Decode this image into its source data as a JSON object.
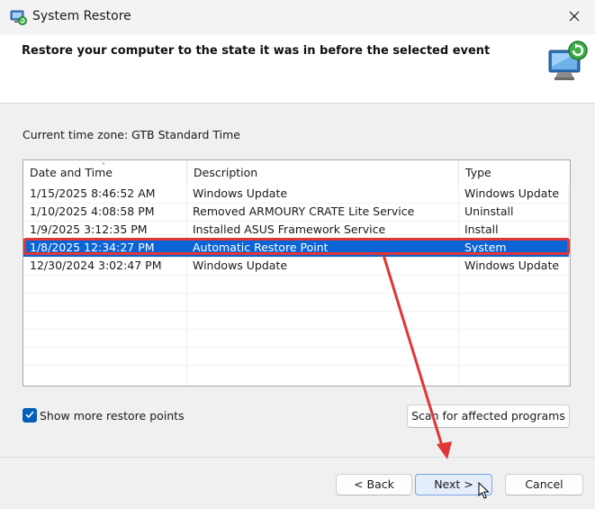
{
  "window": {
    "title": "System Restore",
    "close_icon": "close-icon",
    "app_icon": "system-restore-icon"
  },
  "header": {
    "title": "Restore your computer to the state it was in before the selected event",
    "icon": "system-restore-computer-icon"
  },
  "timezone_label": "Current time zone: GTB Standard Time",
  "list": {
    "columns": [
      "Date and Time",
      "Description",
      "Type"
    ],
    "sort_indicator": "˅",
    "rows": [
      {
        "date": "1/15/2025 8:46:52 AM",
        "description": "Windows Update",
        "type": "Windows Update"
      },
      {
        "date": "1/10/2025 4:08:58 PM",
        "description": "Removed ARMOURY CRATE Lite Service",
        "type": "Uninstall"
      },
      {
        "date": "1/9/2025 3:12:35 PM",
        "description": "Installed ASUS Framework Service",
        "type": "Install"
      },
      {
        "date": "1/8/2025 12:34:27 PM",
        "description": "Automatic Restore Point",
        "type": "System"
      },
      {
        "date": "12/30/2024 3:02:47 PM",
        "description": "Windows Update",
        "type": "Windows Update"
      }
    ],
    "selected_index": 3
  },
  "show_more": {
    "label": "Show more restore points",
    "checked": true
  },
  "buttons": {
    "scan": "Scan for affected programs",
    "back": "< Back",
    "next": "Next >",
    "cancel": "Cancel"
  },
  "colors": {
    "selection": "#0a64d6",
    "annotation": "#e03636",
    "checkbox": "#005fb8"
  }
}
